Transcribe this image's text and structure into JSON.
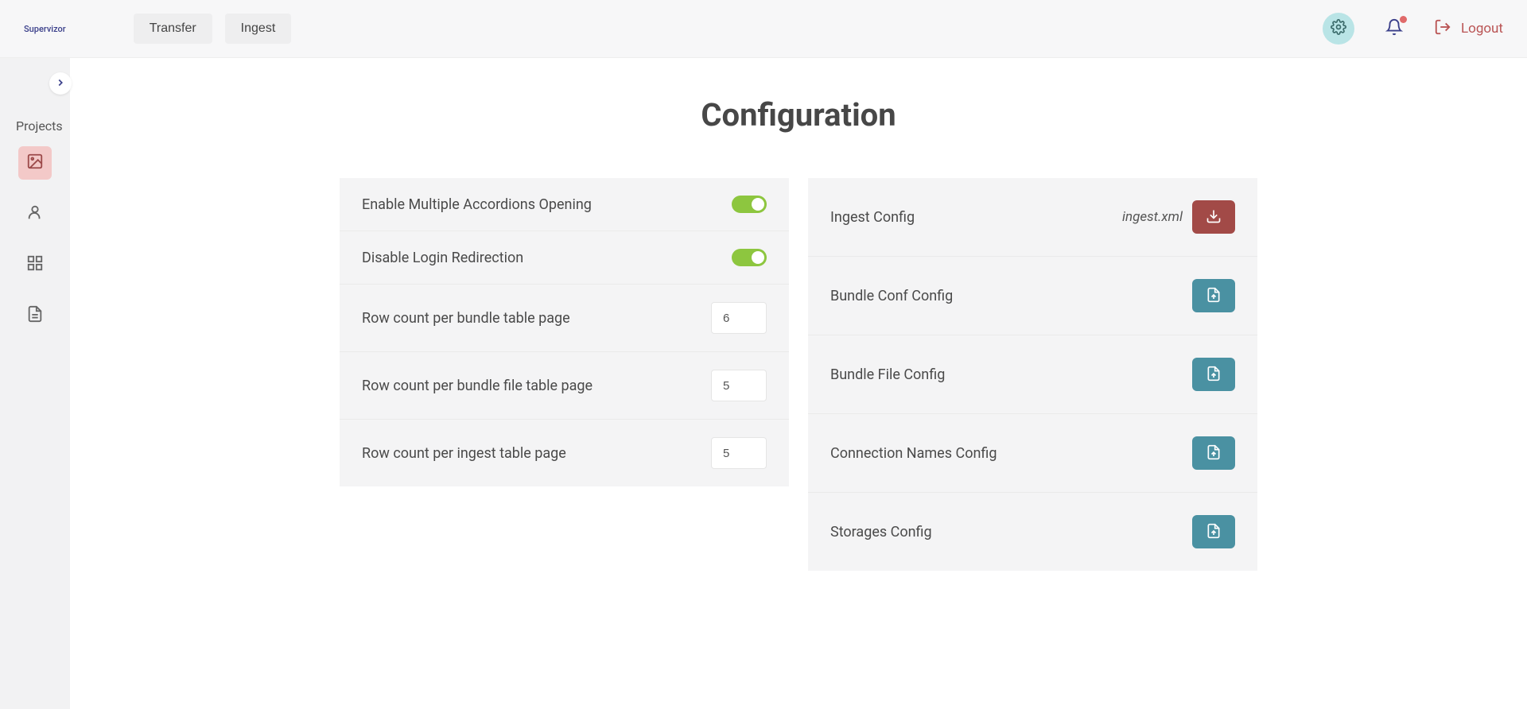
{
  "header": {
    "logo": "Supervizor",
    "nav": {
      "transfer": "Transfer",
      "ingest": "Ingest"
    },
    "logout": "Logout"
  },
  "sidebar": {
    "title": "Projects"
  },
  "page": {
    "title": "Configuration"
  },
  "settings": {
    "accordions": {
      "label": "Enable Multiple Accordions Opening",
      "value": true
    },
    "login_redirect": {
      "label": "Disable Login Redirection",
      "value": true
    },
    "bundle_rows": {
      "label": "Row count per bundle table page",
      "value": "6"
    },
    "bundle_file_rows": {
      "label": "Row count per bundle file table page",
      "value": "5"
    },
    "ingest_rows": {
      "label": "Row count per ingest table page",
      "value": "5"
    }
  },
  "configs": {
    "ingest": {
      "label": "Ingest Config",
      "file": "ingest.xml"
    },
    "bundle_conf": {
      "label": "Bundle Conf Config"
    },
    "bundle_file": {
      "label": "Bundle File Config"
    },
    "connection_names": {
      "label": "Connection Names Config"
    },
    "storages": {
      "label": "Storages Config"
    }
  }
}
